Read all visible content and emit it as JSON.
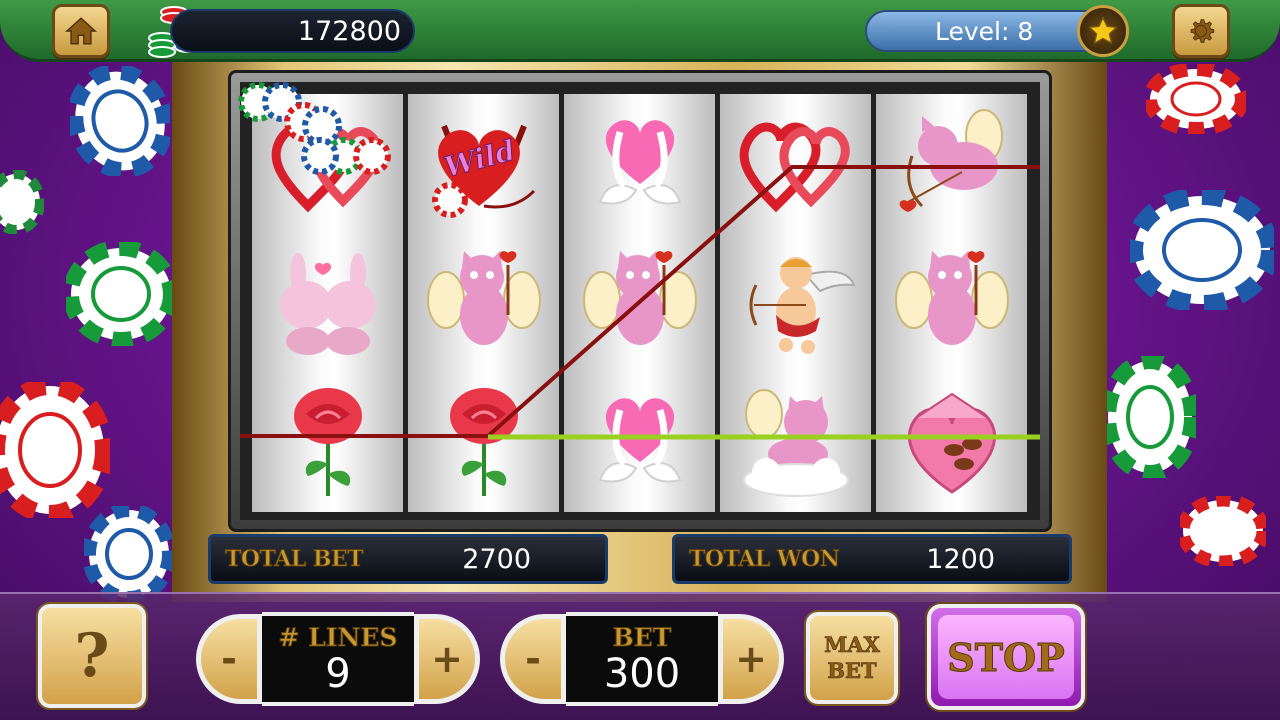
{
  "header": {
    "credits": "172800",
    "level_text": "Level: 8"
  },
  "reels": [
    [
      "linked-hearts",
      "kissing-bunnies",
      "rose"
    ],
    [
      "wild-heart",
      "cupid-cat",
      "rose"
    ],
    [
      "swan-heart",
      "cupid-cat",
      "swan-heart"
    ],
    [
      "linked-hearts",
      "cupid-archer",
      "cloud-cat"
    ],
    [
      "archer-cat",
      "cupid-cat",
      "chocolate-box"
    ]
  ],
  "wild_label": "Wild",
  "info": {
    "total_bet_label": "TOTAL BET",
    "total_bet": "2700",
    "total_won_label": "TOTAL WON",
    "total_won": "1200"
  },
  "controls": {
    "help": "?",
    "minus": "-",
    "plus": "+",
    "lines_label": "# LINES",
    "lines_value": "9",
    "bet_label": "BET",
    "bet_value": "300",
    "max_bet_line1": "MAX",
    "max_bet_line2": "BET",
    "stop_label": "STOP"
  },
  "colors": {
    "topbar": "#2f8a3a",
    "payline_red": "#8a1010",
    "payline_green": "#9ad020",
    "stop_button": "#b84ad8"
  }
}
